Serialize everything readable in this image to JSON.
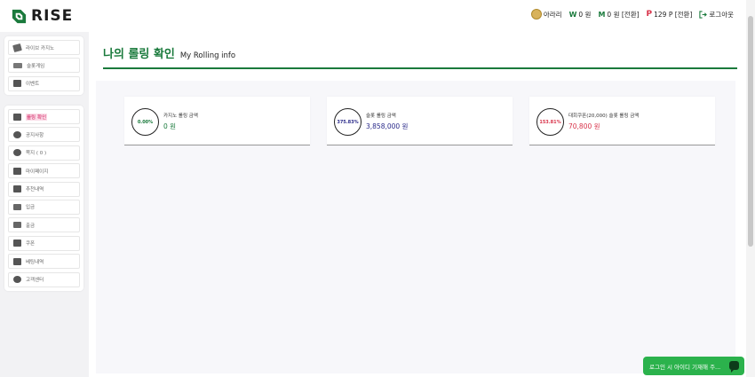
{
  "brand": {
    "name": "RISE",
    "color": "#1a7a3c"
  },
  "header": {
    "user_name": "아라리",
    "cash_symbol": "W",
    "cash_value": "0 원",
    "mileage_symbol": "M",
    "mileage_value": "0 원 [전환]",
    "point_symbol": "P",
    "point_value": "129 P [전환]",
    "logout_label": "로그아웃"
  },
  "sidebar": {
    "group1": [
      {
        "label": "라이브 카지노",
        "icon": "cards-icon"
      },
      {
        "label": "슬롯게임",
        "icon": "slot-icon"
      },
      {
        "label": "이벤트",
        "icon": "event-icon"
      }
    ],
    "group2": [
      {
        "label": "롤링 확인",
        "icon": "rolling-icon",
        "active": true
      },
      {
        "label": "공지사항",
        "icon": "notice-icon"
      },
      {
        "label": "쪽지 ( 0 )",
        "icon": "message-icon"
      },
      {
        "label": "마이페이지",
        "icon": "user-icon"
      },
      {
        "label": "추천내역",
        "icon": "referral-icon"
      },
      {
        "label": "입금",
        "icon": "deposit-icon"
      },
      {
        "label": "출금",
        "icon": "withdraw-icon"
      },
      {
        "label": "쿠폰",
        "icon": "coupon-icon"
      },
      {
        "label": "베팅내역",
        "icon": "betting-icon"
      },
      {
        "label": "고객센터",
        "icon": "support-icon"
      }
    ]
  },
  "main": {
    "title_ko": "나의 롤링 확인",
    "title_en": "My Rolling info",
    "cards": [
      {
        "percent": "0.00%",
        "label": "카지노 롤링 금액",
        "value": "0 원",
        "color": "#1a7a3c"
      },
      {
        "percent": "375.83%",
        "label": "슬롯 롤링 금액",
        "value": "3,858,000 원",
        "color": "#2a2a8a"
      },
      {
        "percent": "153.81%",
        "label": "대회쿠폰(20,000) 슬롯 롤링 금액",
        "value": "70,800 원",
        "color": "#d8334a"
      }
    ]
  },
  "chat": {
    "label": "로그인 시 아이디 기재해 주..."
  }
}
